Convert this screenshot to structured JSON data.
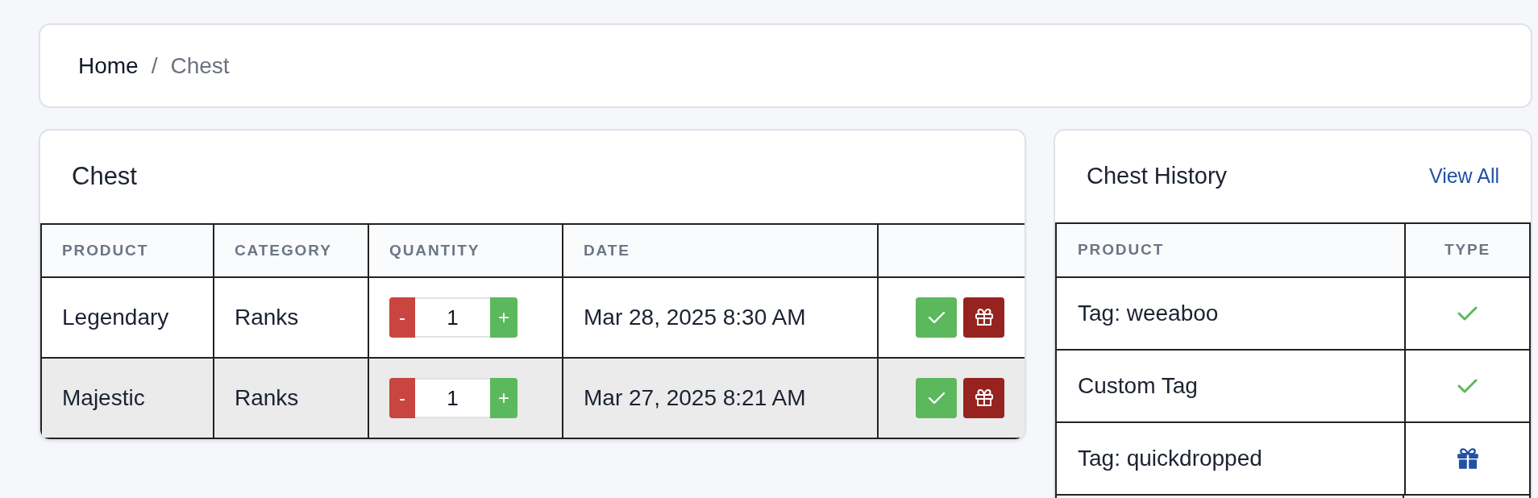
{
  "breadcrumb": {
    "items": [
      {
        "label": "Home",
        "current": false
      },
      {
        "label": "Chest",
        "current": true
      }
    ],
    "separator": "/"
  },
  "chest": {
    "title": "Chest",
    "columns": [
      "PRODUCT",
      "CATEGORY",
      "QUANTITY",
      "DATE"
    ],
    "rows": [
      {
        "product": "Legendary",
        "category": "Ranks",
        "decrement": "-",
        "quantity": "1",
        "increment": "+",
        "date": "Mar 28, 2025 8:30 AM",
        "highlighted": false
      },
      {
        "product": "Majestic",
        "category": "Ranks",
        "decrement": "-",
        "quantity": "1",
        "increment": "+",
        "date": "Mar 27, 2025 8:21 AM",
        "highlighted": true
      }
    ]
  },
  "history": {
    "title": "Chest History",
    "link": "View All",
    "columns": [
      "PRODUCT",
      "TYPE"
    ],
    "rows": [
      {
        "product": "Tag: weeaboo",
        "kind": "check"
      },
      {
        "product": "Custom Tag",
        "kind": "check"
      },
      {
        "product": "Tag: quickdropped",
        "kind": "gift"
      }
    ]
  }
}
